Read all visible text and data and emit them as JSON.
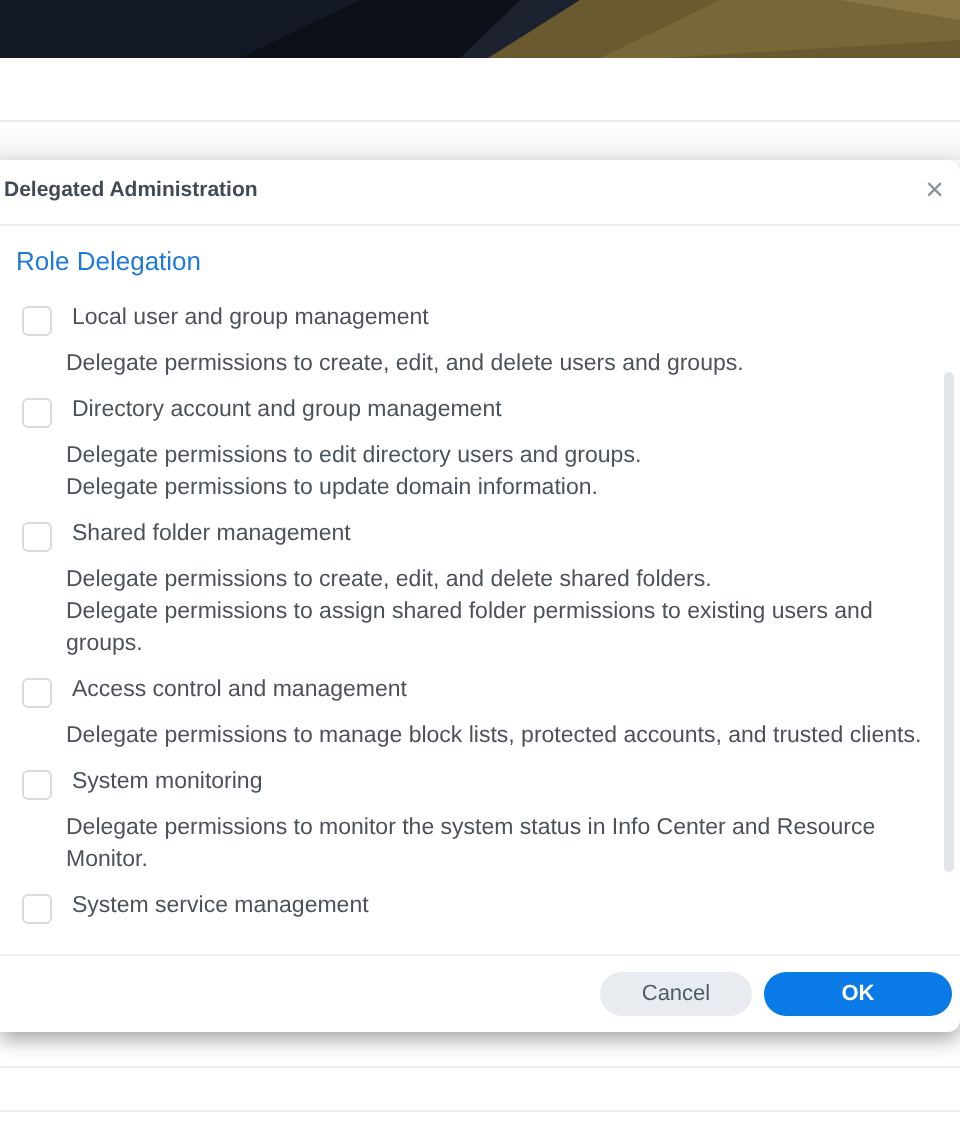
{
  "dialog": {
    "title": "Delegated Administration",
    "close": "×",
    "section": "Role Delegation",
    "roles": [
      {
        "label": "Local user and group management",
        "checked": false,
        "description": [
          "Delegate permissions to create, edit, and delete users and groups."
        ]
      },
      {
        "label": "Directory account and group management",
        "checked": false,
        "description": [
          "Delegate permissions to edit directory users and groups.",
          "Delegate permissions to update domain information."
        ]
      },
      {
        "label": "Shared folder management",
        "checked": false,
        "description": [
          "Delegate permissions to create, edit, and delete shared folders.",
          "Delegate permissions to assign shared folder permissions to existing users and groups."
        ]
      },
      {
        "label": "Access control and management",
        "checked": false,
        "description": [
          "Delegate permissions to manage block lists, protected accounts, and trusted clients."
        ]
      },
      {
        "label": "System monitoring",
        "checked": false,
        "description": [
          "Delegate permissions to monitor the system status in Info Center and Resource Monitor."
        ]
      },
      {
        "label": "System service management",
        "checked": false
      }
    ],
    "buttons": [
      {
        "label": "Cancel",
        "kind": "secondary"
      },
      {
        "label": "OK",
        "kind": "primary"
      }
    ]
  }
}
